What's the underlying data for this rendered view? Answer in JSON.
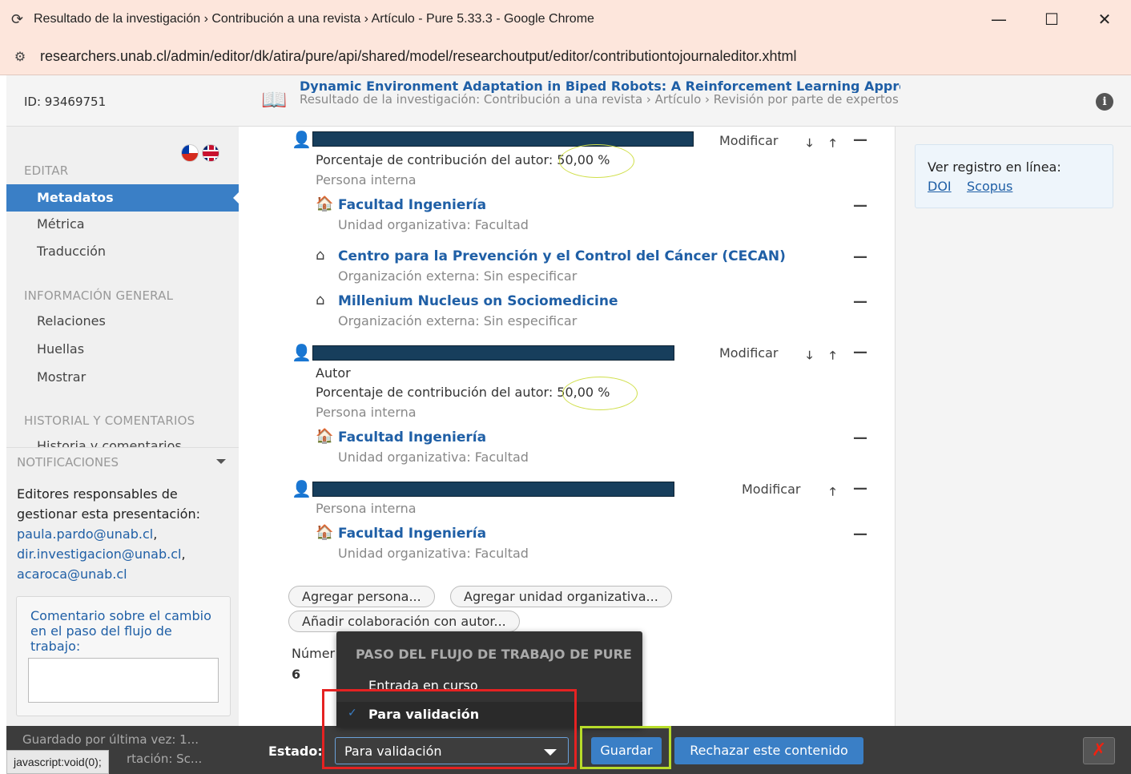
{
  "window": {
    "title": "Resultado de la investigación › Contribución a una revista › Artículo - Pure 5.33.3 - Google Chrome",
    "minimize": "—",
    "maximize": "☐",
    "close": "✕"
  },
  "address": {
    "url": "researchers.unab.cl/admin/editor/dk/atira/pure/api/shared/model/researchoutput/editor/contributiontojournaleditor.xhtml"
  },
  "header": {
    "id_label": "ID: 93469751",
    "record_title": "Dynamic Environment Adaptation in Biped Robots: A Reinforcement Learning Approach",
    "record_subtitle": "Resultado de la investigación: Contribución a una revista › Artículo › Revisión por parte de expertos",
    "info_glyph": "i"
  },
  "sidebar": {
    "sections": {
      "edit": "EDITAR",
      "general": "INFORMACIÓN GENERAL",
      "history": "HISTORIAL Y COMENTARIOS"
    },
    "items": {
      "metadata": "Metadatos",
      "metrics": "Métrica",
      "translation": "Traducción",
      "relations": "Relaciones",
      "fingerprints": "Huellas",
      "show": "Mostrar",
      "history_comments": "Historia y comentarios"
    },
    "notifications": {
      "title": "NOTIFICACIONES",
      "intro": "Editores responsables de gestionar esta presentación:",
      "emails": [
        "paula.pardo@unab.cl",
        "dir.investigacion@unab.cl",
        "acaroca@unab.cl"
      ],
      "separator": ","
    },
    "comment": {
      "label": "Comentario sobre el cambio en el paso del flujo de trabajo:",
      "value": ""
    }
  },
  "main": {
    "actions": {
      "modify": "Modificar",
      "down": "🡓",
      "up": "🡑",
      "remove": "—"
    },
    "persons": [
      {
        "contribution": "Porcentaje de contribución del autor: 50,00 %",
        "type": "Persona interna",
        "orgs": [
          {
            "name": "Facultad Ingeniería",
            "kind": "Unidad organizativa: Facultad"
          },
          {
            "name": "Centro para la Prevención y el Control del Cáncer (CECAN)",
            "kind": "Organización externa: Sin especificar"
          },
          {
            "name": "Millenium Nucleus on Sociomedicine",
            "kind": "Organización externa: Sin especificar"
          }
        ]
      },
      {
        "role": "Autor",
        "contribution": "Porcentaje de contribución del autor: 50,00 %",
        "type": "Persona interna",
        "orgs": [
          {
            "name": "Facultad Ingeniería",
            "kind": "Unidad organizativa: Facultad"
          }
        ]
      },
      {
        "type": "Persona interna",
        "orgs": [
          {
            "name": "Facultad Ingeniería",
            "kind": "Unidad organizativa: Facultad"
          }
        ]
      }
    ],
    "buttons": {
      "add_person": "Agregar persona...",
      "add_org": "Agregar unidad organizativa...",
      "add_collab": "Añadir colaboración con autor..."
    },
    "number_label": "Númer",
    "number_value": "6"
  },
  "right_panel": {
    "label": "Ver registro en línea:",
    "links": [
      "DOI",
      "Scopus"
    ]
  },
  "footer": {
    "saved": "Guardado por última vez: 1...",
    "saved2": "rtación: Sc...",
    "status_label": "Estado:",
    "status_value": "Para validación",
    "save": "Guardar",
    "reject": "Rechazar este contenido",
    "close_glyph": "✗"
  },
  "workflow_popup": {
    "heading": "PASO DEL FLUJO DE TRABAJO DE PURE",
    "options": [
      "Entrada en curso",
      "Para validación"
    ],
    "selected": "Para validación",
    "check": "✓"
  },
  "statusbar": {
    "text": "javascript:void(0);"
  },
  "colors": {
    "accent": "#3a7fc6",
    "link": "#1f5fa6",
    "highlight_red": "#e52222",
    "highlight_green": "#b7dc2a"
  }
}
